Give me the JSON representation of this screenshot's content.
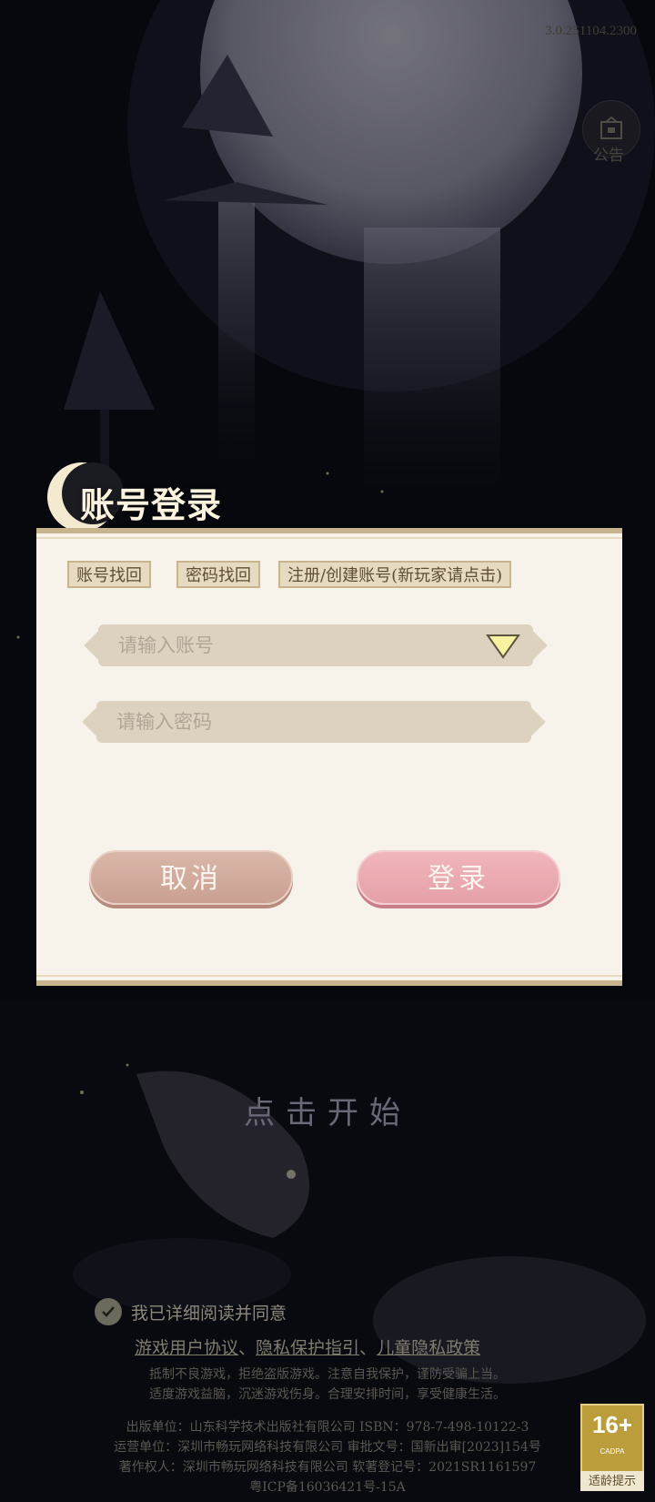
{
  "version": "3.0.251104.2300",
  "side_button": {
    "icon": "map-frame-icon",
    "label": "公告"
  },
  "dialog": {
    "title": "账号登录",
    "actions": [
      {
        "label": "账号找回"
      },
      {
        "label": "密码找回"
      },
      {
        "label": "注册/创建账号(新玩家请点击)"
      }
    ],
    "account_placeholder": "请输入账号",
    "password_placeholder": "请输入密码",
    "cancel_label": "取消",
    "login_label": "登录"
  },
  "start_text": "点击开始",
  "agreement": {
    "text": "我已详细阅读并同意",
    "links": [
      "游戏用户协议",
      "隐私保护指引",
      "儿童隐私政策"
    ],
    "separator": "、"
  },
  "notice_lines": [
    "抵制不良游戏，拒绝盗版游戏。注意自我保护，谨防受骗上当。",
    "适度游戏益脑，沉迷游戏伤身。合理安排时间，享受健康生活。",
    "出版单位：山东科学技术出版社有限公司 ISBN：978-7-498-10122-3",
    "运营单位：深圳市畅玩网络科技有限公司 审批文号：国新出审[2023]154号",
    "著作权人：深圳市畅玩网络科技有限公司 软著登记号：2021SR1161597",
    "粤ICP备16036421号-15A"
  ],
  "age_badge": {
    "rating": "16+",
    "org": "CADPA",
    "tip": "适龄提示"
  },
  "colors": {
    "panel_bg": "#f8f3ea",
    "gold_border": "#c7b48c",
    "cancel_pink": "#caa092",
    "login_pink": "#e5a0a8"
  }
}
